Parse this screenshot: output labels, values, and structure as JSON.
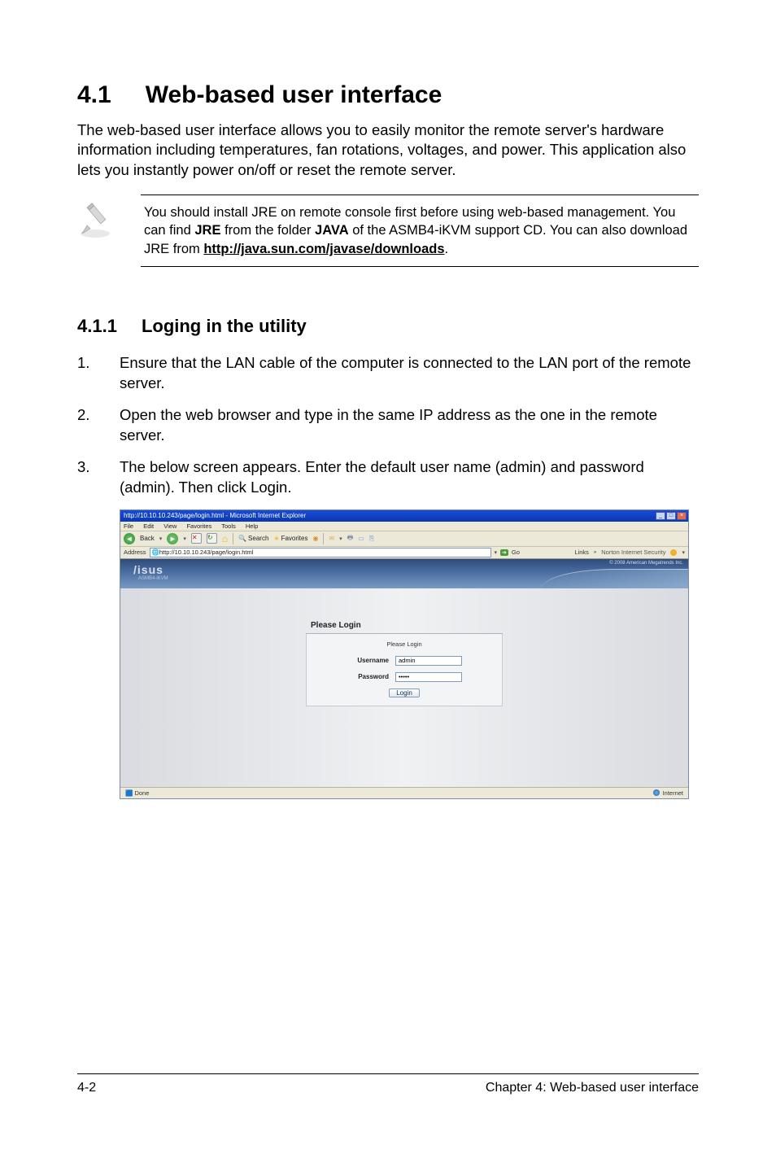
{
  "section": {
    "number": "4.1",
    "title": "Web-based user interface"
  },
  "intro": "The web-based user interface allows you to easily monitor the remote server's hardware information including temperatures, fan rotations, voltages, and power. This application also lets you instantly power on/off or reset the remote server.",
  "note": {
    "pre": "You should install JRE on remote console first before using web-based management. You can find ",
    "b1": "JRE",
    "mid1": " from the folder ",
    "b2": "JAVA",
    "mid2": " of the ASMB4-iKVM support CD. You can also download JRE from ",
    "link": "http://java.sun.com/javase/downloads",
    "post": "."
  },
  "subsection": {
    "number": "4.1.1",
    "title": "Loging in the utility"
  },
  "steps": [
    "Ensure that the LAN cable of the computer is connected to the LAN port of the remote server.",
    "Open the web browser and type in the same IP address as the one in the remote server.",
    "The below screen appears. Enter the default user name (admin) and password (admin). Then click Login."
  ],
  "ie": {
    "title": "http://10.10.10.243/page/login.html - Microsoft Internet Explorer",
    "menus": [
      "File",
      "Edit",
      "View",
      "Favorites",
      "Tools",
      "Help"
    ],
    "toolbar": {
      "back": "Back",
      "search": "Search",
      "favorites": "Favorites"
    },
    "address_label": "Address",
    "address": "http://10.10.10.243/page/login.html",
    "go": "Go",
    "links": "Links",
    "norton": "Norton Internet Security",
    "banner_logo": "/isus",
    "banner_sub": "ASMB4-iKVM",
    "banner_copy": "© 2008 American Megatrends Inc.",
    "login": {
      "header": "Please Login",
      "subheader": "Please Login",
      "username_label": "Username",
      "username_value": "admin",
      "password_label": "Password",
      "password_value": "•••••",
      "button": "Login"
    },
    "status_done": "Done",
    "status_zone": "Internet"
  },
  "footer": {
    "left": "4-2",
    "right": "Chapter 4: Web-based user interface"
  }
}
